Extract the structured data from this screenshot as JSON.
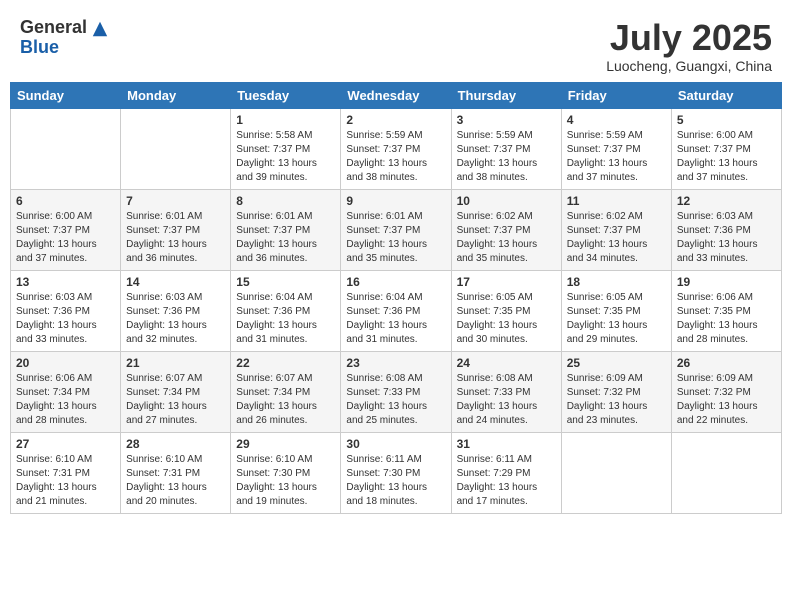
{
  "header": {
    "logo": {
      "general": "General",
      "blue": "Blue"
    },
    "title": "July 2025",
    "location": "Luocheng, Guangxi, China"
  },
  "days_of_week": [
    "Sunday",
    "Monday",
    "Tuesday",
    "Wednesday",
    "Thursday",
    "Friday",
    "Saturday"
  ],
  "weeks": [
    [
      null,
      null,
      {
        "day": 1,
        "sunrise": "5:58 AM",
        "sunset": "7:37 PM",
        "daylight": "13 hours and 39 minutes."
      },
      {
        "day": 2,
        "sunrise": "5:59 AM",
        "sunset": "7:37 PM",
        "daylight": "13 hours and 38 minutes."
      },
      {
        "day": 3,
        "sunrise": "5:59 AM",
        "sunset": "7:37 PM",
        "daylight": "13 hours and 38 minutes."
      },
      {
        "day": 4,
        "sunrise": "5:59 AM",
        "sunset": "7:37 PM",
        "daylight": "13 hours and 37 minutes."
      },
      {
        "day": 5,
        "sunrise": "6:00 AM",
        "sunset": "7:37 PM",
        "daylight": "13 hours and 37 minutes."
      }
    ],
    [
      {
        "day": 6,
        "sunrise": "6:00 AM",
        "sunset": "7:37 PM",
        "daylight": "13 hours and 37 minutes."
      },
      {
        "day": 7,
        "sunrise": "6:01 AM",
        "sunset": "7:37 PM",
        "daylight": "13 hours and 36 minutes."
      },
      {
        "day": 8,
        "sunrise": "6:01 AM",
        "sunset": "7:37 PM",
        "daylight": "13 hours and 36 minutes."
      },
      {
        "day": 9,
        "sunrise": "6:01 AM",
        "sunset": "7:37 PM",
        "daylight": "13 hours and 35 minutes."
      },
      {
        "day": 10,
        "sunrise": "6:02 AM",
        "sunset": "7:37 PM",
        "daylight": "13 hours and 35 minutes."
      },
      {
        "day": 11,
        "sunrise": "6:02 AM",
        "sunset": "7:37 PM",
        "daylight": "13 hours and 34 minutes."
      },
      {
        "day": 12,
        "sunrise": "6:03 AM",
        "sunset": "7:36 PM",
        "daylight": "13 hours and 33 minutes."
      }
    ],
    [
      {
        "day": 13,
        "sunrise": "6:03 AM",
        "sunset": "7:36 PM",
        "daylight": "13 hours and 33 minutes."
      },
      {
        "day": 14,
        "sunrise": "6:03 AM",
        "sunset": "7:36 PM",
        "daylight": "13 hours and 32 minutes."
      },
      {
        "day": 15,
        "sunrise": "6:04 AM",
        "sunset": "7:36 PM",
        "daylight": "13 hours and 31 minutes."
      },
      {
        "day": 16,
        "sunrise": "6:04 AM",
        "sunset": "7:36 PM",
        "daylight": "13 hours and 31 minutes."
      },
      {
        "day": 17,
        "sunrise": "6:05 AM",
        "sunset": "7:35 PM",
        "daylight": "13 hours and 30 minutes."
      },
      {
        "day": 18,
        "sunrise": "6:05 AM",
        "sunset": "7:35 PM",
        "daylight": "13 hours and 29 minutes."
      },
      {
        "day": 19,
        "sunrise": "6:06 AM",
        "sunset": "7:35 PM",
        "daylight": "13 hours and 28 minutes."
      }
    ],
    [
      {
        "day": 20,
        "sunrise": "6:06 AM",
        "sunset": "7:34 PM",
        "daylight": "13 hours and 28 minutes."
      },
      {
        "day": 21,
        "sunrise": "6:07 AM",
        "sunset": "7:34 PM",
        "daylight": "13 hours and 27 minutes."
      },
      {
        "day": 22,
        "sunrise": "6:07 AM",
        "sunset": "7:34 PM",
        "daylight": "13 hours and 26 minutes."
      },
      {
        "day": 23,
        "sunrise": "6:08 AM",
        "sunset": "7:33 PM",
        "daylight": "13 hours and 25 minutes."
      },
      {
        "day": 24,
        "sunrise": "6:08 AM",
        "sunset": "7:33 PM",
        "daylight": "13 hours and 24 minutes."
      },
      {
        "day": 25,
        "sunrise": "6:09 AM",
        "sunset": "7:32 PM",
        "daylight": "13 hours and 23 minutes."
      },
      {
        "day": 26,
        "sunrise": "6:09 AM",
        "sunset": "7:32 PM",
        "daylight": "13 hours and 22 minutes."
      }
    ],
    [
      {
        "day": 27,
        "sunrise": "6:10 AM",
        "sunset": "7:31 PM",
        "daylight": "13 hours and 21 minutes."
      },
      {
        "day": 28,
        "sunrise": "6:10 AM",
        "sunset": "7:31 PM",
        "daylight": "13 hours and 20 minutes."
      },
      {
        "day": 29,
        "sunrise": "6:10 AM",
        "sunset": "7:30 PM",
        "daylight": "13 hours and 19 minutes."
      },
      {
        "day": 30,
        "sunrise": "6:11 AM",
        "sunset": "7:30 PM",
        "daylight": "13 hours and 18 minutes."
      },
      {
        "day": 31,
        "sunrise": "6:11 AM",
        "sunset": "7:29 PM",
        "daylight": "13 hours and 17 minutes."
      },
      null,
      null
    ]
  ]
}
